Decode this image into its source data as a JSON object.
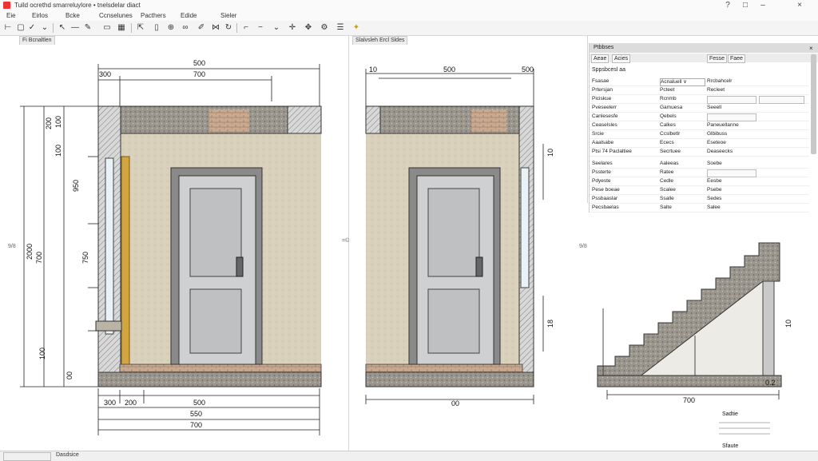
{
  "window": {
    "title": "Tuild ocrethd smarreluylore • tnelsdelar diact",
    "controls": [
      "?",
      "□",
      "–",
      "×"
    ]
  },
  "menu": [
    "Eie",
    "Eirlos",
    "Bcke",
    "Ccnselunes",
    "Pacthers",
    "Edide",
    "Sieler"
  ],
  "tabs": {
    "left": "Fi  Bcnaltlen",
    "middle": "Slalvsleh Ercl Sldes"
  },
  "side_markers": {
    "left": "9/8",
    "middle": "=©",
    "right": "9/8"
  },
  "properties": {
    "title": "Ptbbses",
    "tabs": [
      "Aeae",
      "Acies",
      "Fesse",
      "Faee"
    ],
    "section": "Sppsbcesl  aa",
    "rows": [
      {
        "label": "Fsasae",
        "c2": "Acnaluell  ∨",
        "c3": "Rrcbahcelr"
      },
      {
        "label": "Prtersjan",
        "c2": "Pcteet",
        "c3": "Recleet"
      },
      {
        "label": "Piciskue",
        "c2": "Rcnmb",
        "c3": ""
      },
      {
        "label": "Pveseelerr",
        "c2": "Gamuesa",
        "c3": "Seeell"
      },
      {
        "label": "Canlesesfe",
        "c2": "Qebels",
        "c3": ""
      },
      {
        "label": "Ceaselsles",
        "c2": "Calkes",
        "c3": "Paneuellanne"
      },
      {
        "label": "Srcie",
        "c2": "Ccslbetlr",
        "c3": "Glbibuss"
      },
      {
        "label": "Aaalsabe",
        "c2": "Ececs",
        "c3": "Eseteoe"
      },
      {
        "label": "Ptsi 74 Paclaltiee",
        "c2": "Secrtuee",
        "c3": "Deaseecks"
      }
    ],
    "rows2": [
      {
        "label": "Seelares",
        "c2": "Aaleeas",
        "c3": "Soebe"
      },
      {
        "label": "Pssterte",
        "c2": "Ratee",
        "c3": ""
      },
      {
        "label": "Pdyeste",
        "c2": "Cedle",
        "c3": "Eesbe"
      },
      {
        "label": "Pese boeae",
        "c2": "Scalee",
        "c3": "Psebe"
      },
      {
        "label": "Pssbaaslar",
        "c2": "Ssalle",
        "c3": "Sedes"
      },
      {
        "label": "Pecsbaelas",
        "c2": "Salte",
        "c3": "Salee"
      }
    ]
  },
  "drawing1": {
    "dims_top": [
      "500",
      "300",
      "700"
    ],
    "dims_left": [
      "200",
      "100",
      "100",
      "950",
      "700",
      "750",
      "100",
      "00",
      "2000"
    ],
    "dims_bottom": [
      "300",
      "200",
      "500",
      "550",
      "700"
    ]
  },
  "drawing2": {
    "dims_top": [
      "10",
      "500",
      "500"
    ],
    "dims_right": [
      "10",
      "18"
    ],
    "dims_bottom": [
      "00"
    ]
  },
  "drawing3": {
    "dims_bottom": [
      "700"
    ],
    "dims_right": [
      "10",
      "0.2"
    ],
    "notes": [
      "Sadtie",
      "Sfaute"
    ]
  },
  "status": [
    "",
    "Dasdsice"
  ]
}
